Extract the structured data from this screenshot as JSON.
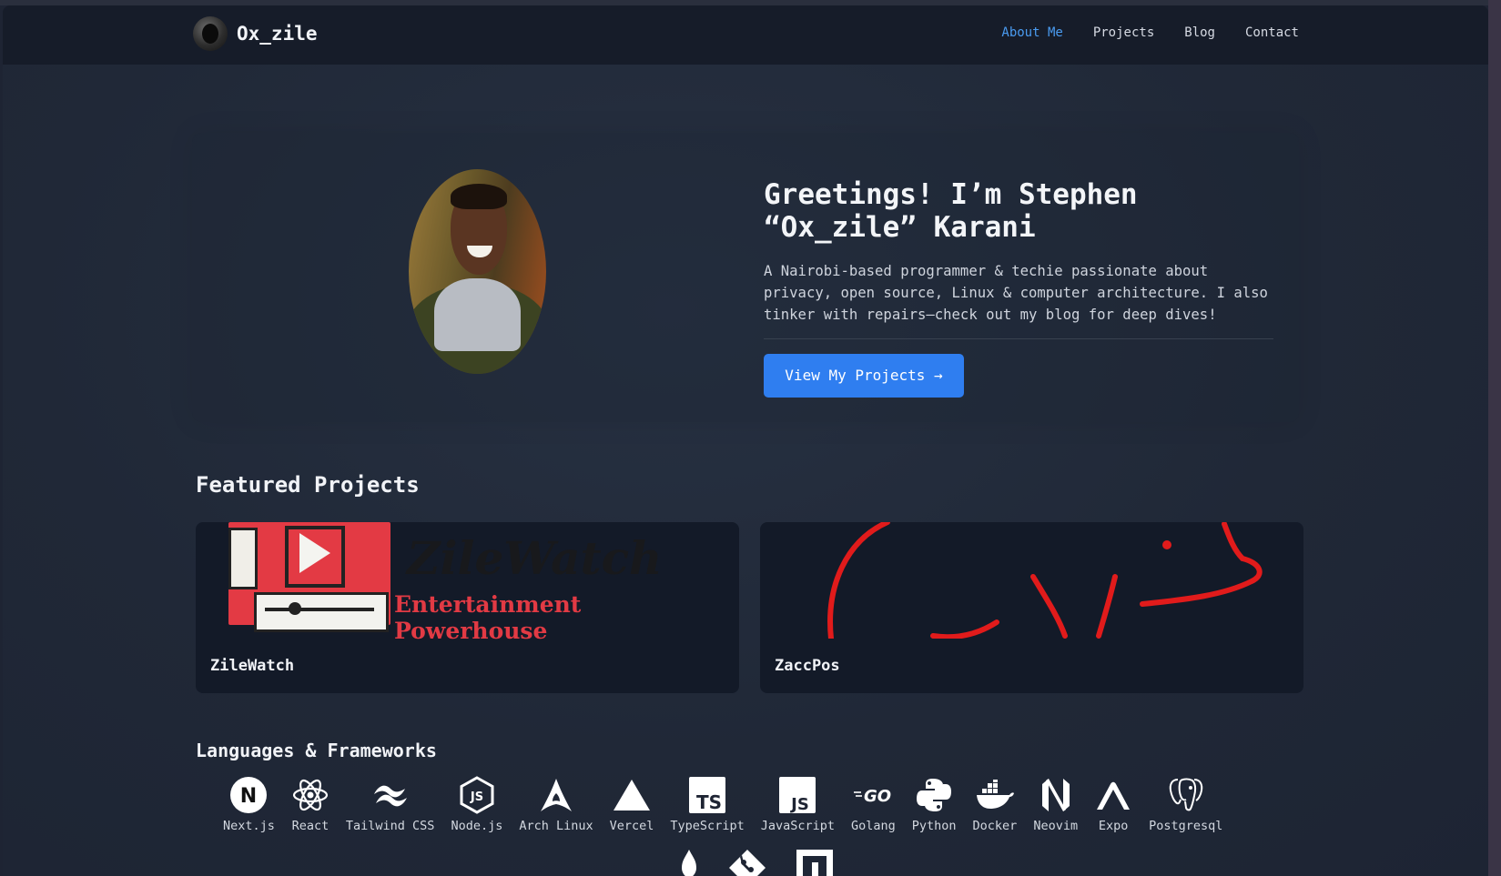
{
  "nav": {
    "brand": "Ox_zile",
    "links": [
      {
        "label": "About Me",
        "active": true
      },
      {
        "label": "Projects",
        "active": false
      },
      {
        "label": "Blog",
        "active": false
      },
      {
        "label": "Contact",
        "active": false
      }
    ]
  },
  "hero": {
    "title": "Greetings! I’m Stephen “Ox_zile” Karani",
    "description": "A Nairobi-based programmer & techie passionate about privacy, open source, Linux & computer architecture. I also tinker with repairs—check out my blog for deep dives!",
    "cta_label": "View My Projects →"
  },
  "featured": {
    "title": "Featured Projects",
    "projects": [
      {
        "name": "ZileWatch",
        "thumb_title": "ZileWatch",
        "thumb_subtitle": "Entertainment Powerhouse"
      },
      {
        "name": "ZaccPos"
      }
    ]
  },
  "languages": {
    "title": "Languages & Frameworks",
    "items": [
      {
        "name": "Next.js",
        "icon": "nextjs-icon"
      },
      {
        "name": "React",
        "icon": "react-icon"
      },
      {
        "name": "Tailwind CSS",
        "icon": "tailwind-icon"
      },
      {
        "name": "Node.js",
        "icon": "nodejs-icon"
      },
      {
        "name": "Arch Linux",
        "icon": "arch-icon"
      },
      {
        "name": "Vercel",
        "icon": "vercel-icon"
      },
      {
        "name": "TypeScript",
        "icon": "typescript-icon"
      },
      {
        "name": "JavaScript",
        "icon": "javascript-icon"
      },
      {
        "name": "Golang",
        "icon": "golang-icon"
      },
      {
        "name": "Python",
        "icon": "python-icon"
      },
      {
        "name": "Docker",
        "icon": "docker-icon"
      },
      {
        "name": "Neovim",
        "icon": "neovim-icon"
      },
      {
        "name": "Expo",
        "icon": "expo-icon"
      },
      {
        "name": "Postgresql",
        "icon": "postgresql-icon"
      }
    ],
    "row2_icons": [
      "mongodb-icon",
      "git-icon",
      "npm-icon"
    ]
  },
  "colors": {
    "accent": "#2f7ef0",
    "nav_active": "#4a9bf0",
    "background": "#1e2433"
  }
}
